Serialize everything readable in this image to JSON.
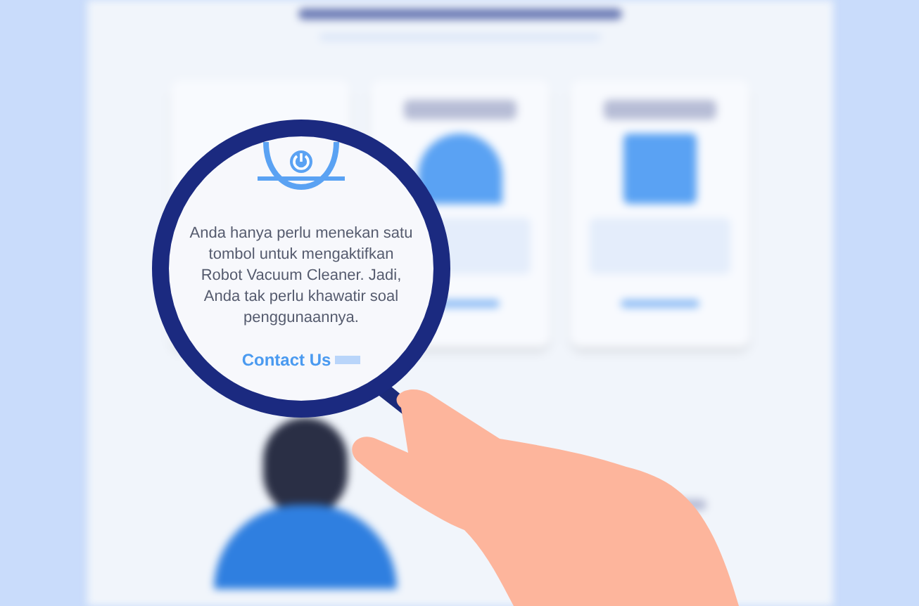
{
  "lens": {
    "text": "Anda hanya perlu menekan satu tombol untuk mengaktifkan Robot Vacuum Cleaner. Jadi, Anda tak perlu khawatir soal penggunaannya.",
    "link": "Contact Us"
  }
}
